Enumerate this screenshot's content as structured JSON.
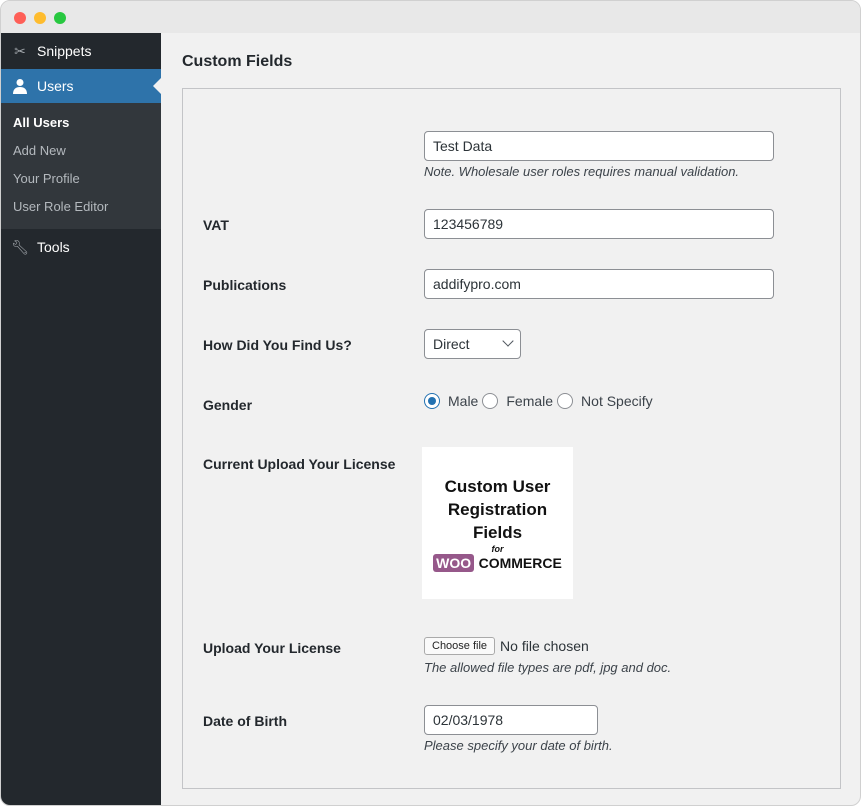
{
  "sidebar": {
    "menu": [
      {
        "label": "Snippets",
        "icon": "scissors-icon"
      },
      {
        "label": "Users",
        "icon": "user-icon"
      },
      {
        "label": "Tools",
        "icon": "wrench-icon"
      }
    ],
    "submenu": [
      "All Users",
      "Add New",
      "Your Profile",
      "User Role Editor"
    ]
  },
  "main": {
    "title": "Custom Fields",
    "fields": {
      "test": {
        "value": "Test Data",
        "note": "Note. Wholesale user roles requires manual validation."
      },
      "vat": {
        "label": "VAT",
        "value": "123456789"
      },
      "publications": {
        "label": "Publications",
        "value": "addifypro.com"
      },
      "find": {
        "label": "How Did You Find Us?",
        "value": "Direct"
      },
      "gender": {
        "label": "Gender",
        "options": [
          "Male",
          "Female",
          "Not Specify"
        ],
        "selected": "Male"
      },
      "current_license": {
        "label": "Current Upload Your License",
        "image_text": [
          "Custom User",
          "Registration Fields",
          "for",
          "WOO",
          "COMMERCE"
        ]
      },
      "upload": {
        "label": "Upload Your License",
        "button": "Choose file",
        "status": "No file chosen",
        "note": "The allowed file types are pdf, jpg and doc."
      },
      "dob": {
        "label": "Date of Birth",
        "value": "02/03/1978",
        "note": "Please specify your date of birth."
      }
    }
  },
  "colors": {
    "sidebar": "#23282d",
    "active": "#2e73aa",
    "accent": "#2271b1"
  }
}
